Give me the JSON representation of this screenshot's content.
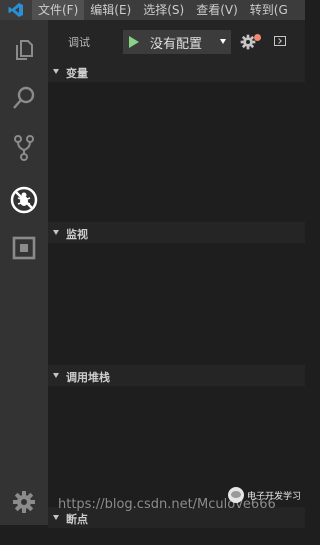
{
  "menubar": {
    "items": [
      "文件(F)",
      "编辑(E)",
      "选择(S)",
      "查看(V)",
      "转到(G"
    ]
  },
  "activity_bar": {
    "items": [
      {
        "icon": "files-icon"
      },
      {
        "icon": "search-icon"
      },
      {
        "icon": "source-control-icon"
      },
      {
        "icon": "debug-icon",
        "active": true
      },
      {
        "icon": "extensions-icon"
      }
    ],
    "bottom_icon": "gear-icon"
  },
  "debug": {
    "title": "调试",
    "config": "没有配置"
  },
  "sections": {
    "variables": "变量",
    "watch": "监视",
    "call_stack": "调用堆栈",
    "breakpoints": "断点"
  },
  "watermark": {
    "url": "https://blog.csdn.net/Mculove666",
    "wechat": "电子开发学习"
  },
  "colors": {
    "accent": "#007acc",
    "run": "#89d185",
    "badge": "#f48771"
  }
}
